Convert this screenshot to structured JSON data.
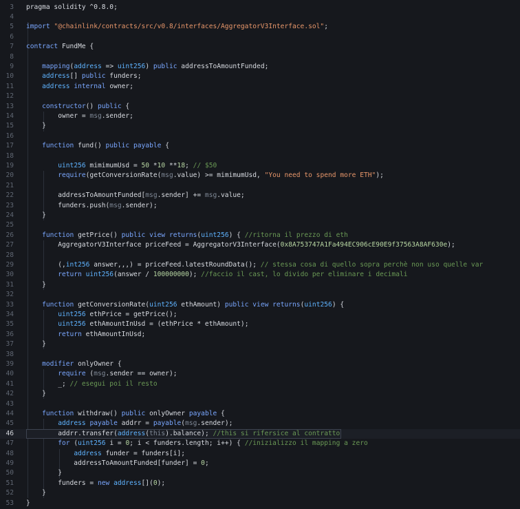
{
  "editor": {
    "language": "solidity",
    "active_line": 46,
    "colors": {
      "background": "#16181d",
      "keyword": "#7aa7ff",
      "type": "#5fb3ff",
      "string": "#e7966a",
      "number": "#b8d7a3",
      "comment": "#6a9955",
      "dim": "#7f8896",
      "gutter": "#5f6672"
    },
    "lines": [
      {
        "num": "3",
        "tokens": [
          {
            "t": "pragma solidity ^0.8.0;",
            "c": "id"
          }
        ]
      },
      {
        "num": "4",
        "tokens": []
      },
      {
        "num": "5",
        "tokens": [
          {
            "t": "import ",
            "c": "kw"
          },
          {
            "t": "\"@chainlink/contracts/src/v0.8/interfaces/AggregatorV3Interface.sol\"",
            "c": "str"
          },
          {
            "t": ";",
            "c": "id"
          }
        ]
      },
      {
        "num": "6",
        "tokens": []
      },
      {
        "num": "7",
        "tokens": [
          {
            "t": "contract ",
            "c": "kw"
          },
          {
            "t": "FundMe {",
            "c": "id"
          }
        ]
      },
      {
        "num": "8",
        "tokens": []
      },
      {
        "num": "9",
        "tokens": [
          {
            "t": "    ",
            "c": "id"
          },
          {
            "t": "mapping",
            "c": "kw"
          },
          {
            "t": "(",
            "c": "id"
          },
          {
            "t": "address",
            "c": "type"
          },
          {
            "t": " => ",
            "c": "id"
          },
          {
            "t": "uint256",
            "c": "type"
          },
          {
            "t": ") ",
            "c": "id"
          },
          {
            "t": "public",
            "c": "kw"
          },
          {
            "t": " addressToAmountFunded;",
            "c": "id"
          }
        ]
      },
      {
        "num": "10",
        "tokens": [
          {
            "t": "    ",
            "c": "id"
          },
          {
            "t": "address",
            "c": "type"
          },
          {
            "t": "[] ",
            "c": "id"
          },
          {
            "t": "public",
            "c": "kw"
          },
          {
            "t": " funders;",
            "c": "id"
          }
        ]
      },
      {
        "num": "11",
        "tokens": [
          {
            "t": "    ",
            "c": "id"
          },
          {
            "t": "address",
            "c": "type"
          },
          {
            "t": " ",
            "c": "id"
          },
          {
            "t": "internal",
            "c": "kw"
          },
          {
            "t": " owner;",
            "c": "id"
          }
        ]
      },
      {
        "num": "12",
        "tokens": []
      },
      {
        "num": "13",
        "tokens": [
          {
            "t": "    ",
            "c": "id"
          },
          {
            "t": "constructor",
            "c": "kw"
          },
          {
            "t": "() ",
            "c": "id"
          },
          {
            "t": "public",
            "c": "kw"
          },
          {
            "t": " {",
            "c": "id"
          }
        ]
      },
      {
        "num": "14",
        "tokens": [
          {
            "t": "        owner = ",
            "c": "id"
          },
          {
            "t": "msg",
            "c": "dim"
          },
          {
            "t": ".sender;",
            "c": "id"
          }
        ]
      },
      {
        "num": "15",
        "tokens": [
          {
            "t": "    }",
            "c": "id"
          }
        ]
      },
      {
        "num": "16",
        "tokens": []
      },
      {
        "num": "17",
        "tokens": [
          {
            "t": "    ",
            "c": "id"
          },
          {
            "t": "function",
            "c": "kw"
          },
          {
            "t": " fund() ",
            "c": "id"
          },
          {
            "t": "public",
            "c": "kw"
          },
          {
            "t": " ",
            "c": "id"
          },
          {
            "t": "payable",
            "c": "kw"
          },
          {
            "t": " {",
            "c": "id"
          }
        ]
      },
      {
        "num": "18",
        "tokens": []
      },
      {
        "num": "19",
        "tokens": [
          {
            "t": "        ",
            "c": "id"
          },
          {
            "t": "uint256",
            "c": "type"
          },
          {
            "t": " mimimumUsd = ",
            "c": "id"
          },
          {
            "t": "50",
            "c": "num"
          },
          {
            "t": " *",
            "c": "id"
          },
          {
            "t": "10",
            "c": "num"
          },
          {
            "t": " **",
            "c": "id"
          },
          {
            "t": "18",
            "c": "num"
          },
          {
            "t": "; ",
            "c": "id"
          },
          {
            "t": "// $50",
            "c": "cmt"
          }
        ]
      },
      {
        "num": "20",
        "tokens": [
          {
            "t": "        ",
            "c": "id"
          },
          {
            "t": "require",
            "c": "kw"
          },
          {
            "t": "(getConversionRate(",
            "c": "id"
          },
          {
            "t": "msg",
            "c": "dim"
          },
          {
            "t": ".value) >= mimimumUsd, ",
            "c": "id"
          },
          {
            "t": "\"You need to spend more ETH\"",
            "c": "str"
          },
          {
            "t": ");",
            "c": "id"
          }
        ]
      },
      {
        "num": "21",
        "tokens": []
      },
      {
        "num": "22",
        "tokens": [
          {
            "t": "        addressToAmountFunded[",
            "c": "id"
          },
          {
            "t": "msg",
            "c": "dim"
          },
          {
            "t": ".sender] += ",
            "c": "id"
          },
          {
            "t": "msg",
            "c": "dim"
          },
          {
            "t": ".value;",
            "c": "id"
          }
        ]
      },
      {
        "num": "23",
        "tokens": [
          {
            "t": "        funders.push(",
            "c": "id"
          },
          {
            "t": "msg",
            "c": "dim"
          },
          {
            "t": ".sender);",
            "c": "id"
          }
        ]
      },
      {
        "num": "24",
        "tokens": [
          {
            "t": "    }",
            "c": "id"
          }
        ]
      },
      {
        "num": "25",
        "tokens": []
      },
      {
        "num": "26",
        "tokens": [
          {
            "t": "    ",
            "c": "id"
          },
          {
            "t": "function",
            "c": "kw"
          },
          {
            "t": " getPrice() ",
            "c": "id"
          },
          {
            "t": "public",
            "c": "kw"
          },
          {
            "t": " ",
            "c": "id"
          },
          {
            "t": "view",
            "c": "kw"
          },
          {
            "t": " ",
            "c": "id"
          },
          {
            "t": "returns",
            "c": "kw"
          },
          {
            "t": "(",
            "c": "id"
          },
          {
            "t": "uint256",
            "c": "type"
          },
          {
            "t": ") { ",
            "c": "id"
          },
          {
            "t": "//ritorna il prezzo di eth",
            "c": "cmt"
          }
        ]
      },
      {
        "num": "27",
        "tokens": [
          {
            "t": "        AggregatorV3Interface priceFeed = AggregatorV3Interface(",
            "c": "id"
          },
          {
            "t": "0x8A753747A1Fa494EC906cE90E9f37563A8AF630e",
            "c": "num"
          },
          {
            "t": ");",
            "c": "id"
          }
        ]
      },
      {
        "num": "28",
        "tokens": []
      },
      {
        "num": "29",
        "tokens": [
          {
            "t": "        (,",
            "c": "id"
          },
          {
            "t": "int256",
            "c": "type"
          },
          {
            "t": " answer,,,) = priceFeed.latestRoundData(); ",
            "c": "id"
          },
          {
            "t": "// stessa cosa di quello sopra perchè non uso quelle var",
            "c": "cmt"
          }
        ]
      },
      {
        "num": "30",
        "tokens": [
          {
            "t": "        ",
            "c": "id"
          },
          {
            "t": "return",
            "c": "kw"
          },
          {
            "t": " ",
            "c": "id"
          },
          {
            "t": "uint256",
            "c": "type"
          },
          {
            "t": "(answer / ",
            "c": "id"
          },
          {
            "t": "100000000",
            "c": "num"
          },
          {
            "t": "); ",
            "c": "id"
          },
          {
            "t": "//faccio il cast, lo divido per eliminare i decimali",
            "c": "cmt"
          }
        ]
      },
      {
        "num": "31",
        "tokens": [
          {
            "t": "    }",
            "c": "id"
          }
        ]
      },
      {
        "num": "32",
        "tokens": []
      },
      {
        "num": "33",
        "tokens": [
          {
            "t": "    ",
            "c": "id"
          },
          {
            "t": "function",
            "c": "kw"
          },
          {
            "t": " getConversionRate(",
            "c": "id"
          },
          {
            "t": "uint256",
            "c": "type"
          },
          {
            "t": " ethAmount) ",
            "c": "id"
          },
          {
            "t": "public",
            "c": "kw"
          },
          {
            "t": " ",
            "c": "id"
          },
          {
            "t": "view",
            "c": "kw"
          },
          {
            "t": " ",
            "c": "id"
          },
          {
            "t": "returns",
            "c": "kw"
          },
          {
            "t": "(",
            "c": "id"
          },
          {
            "t": "uint256",
            "c": "type"
          },
          {
            "t": ") {",
            "c": "id"
          }
        ]
      },
      {
        "num": "34",
        "tokens": [
          {
            "t": "        ",
            "c": "id"
          },
          {
            "t": "uint256",
            "c": "type"
          },
          {
            "t": " ethPrice = getPrice();",
            "c": "id"
          }
        ]
      },
      {
        "num": "35",
        "tokens": [
          {
            "t": "        ",
            "c": "id"
          },
          {
            "t": "uint256",
            "c": "type"
          },
          {
            "t": " ethAmountInUsd = (ethPrice * ethAmount);",
            "c": "id"
          }
        ]
      },
      {
        "num": "36",
        "tokens": [
          {
            "t": "        ",
            "c": "id"
          },
          {
            "t": "return",
            "c": "kw"
          },
          {
            "t": " ethAmountInUsd;",
            "c": "id"
          }
        ]
      },
      {
        "num": "37",
        "tokens": [
          {
            "t": "    }",
            "c": "id"
          }
        ]
      },
      {
        "num": "38",
        "tokens": []
      },
      {
        "num": "39",
        "tokens": [
          {
            "t": "    ",
            "c": "id"
          },
          {
            "t": "modifier",
            "c": "kw"
          },
          {
            "t": " onlyOwner {",
            "c": "id"
          }
        ]
      },
      {
        "num": "40",
        "tokens": [
          {
            "t": "        ",
            "c": "id"
          },
          {
            "t": "require",
            "c": "kw"
          },
          {
            "t": " (",
            "c": "id"
          },
          {
            "t": "msg",
            "c": "dim"
          },
          {
            "t": ".sender == owner);",
            "c": "id"
          }
        ]
      },
      {
        "num": "41",
        "tokens": [
          {
            "t": "        _; ",
            "c": "id"
          },
          {
            "t": "// esegui poi il resto",
            "c": "cmt"
          }
        ]
      },
      {
        "num": "42",
        "tokens": [
          {
            "t": "    }",
            "c": "id"
          }
        ]
      },
      {
        "num": "43",
        "tokens": []
      },
      {
        "num": "44",
        "tokens": [
          {
            "t": "    ",
            "c": "id"
          },
          {
            "t": "function",
            "c": "kw"
          },
          {
            "t": " withdraw() ",
            "c": "id"
          },
          {
            "t": "public",
            "c": "kw"
          },
          {
            "t": " onlyOwner ",
            "c": "id"
          },
          {
            "t": "payable",
            "c": "kw"
          },
          {
            "t": " {",
            "c": "id"
          }
        ]
      },
      {
        "num": "45",
        "tokens": [
          {
            "t": "        ",
            "c": "id"
          },
          {
            "t": "address",
            "c": "type"
          },
          {
            "t": " ",
            "c": "id"
          },
          {
            "t": "payable",
            "c": "kw"
          },
          {
            "t": " addrr = ",
            "c": "id"
          },
          {
            "t": "payable",
            "c": "kw"
          },
          {
            "t": "(",
            "c": "id"
          },
          {
            "t": "msg",
            "c": "dim"
          },
          {
            "t": ".sender);",
            "c": "id"
          }
        ]
      },
      {
        "num": "46",
        "tokens": [
          {
            "t": "        addrr.transfer(",
            "c": "id"
          },
          {
            "t": "address",
            "c": "type"
          },
          {
            "t": "(",
            "c": "id"
          },
          {
            "t": "this",
            "c": "dim"
          },
          {
            "t": ").balance); ",
            "c": "id"
          },
          {
            "t": "//this si rifersice al contratto",
            "c": "cmt"
          }
        ]
      },
      {
        "num": "47",
        "tokens": [
          {
            "t": "        ",
            "c": "id"
          },
          {
            "t": "for",
            "c": "kw"
          },
          {
            "t": " (",
            "c": "id"
          },
          {
            "t": "uint256",
            "c": "type"
          },
          {
            "t": " i = ",
            "c": "id"
          },
          {
            "t": "0",
            "c": "num"
          },
          {
            "t": "; i < funders.length; i++) { ",
            "c": "id"
          },
          {
            "t": "//inizializzo il mapping a zero",
            "c": "cmt"
          }
        ]
      },
      {
        "num": "48",
        "tokens": [
          {
            "t": "            ",
            "c": "id"
          },
          {
            "t": "address",
            "c": "type"
          },
          {
            "t": " funder = funders[i];",
            "c": "id"
          }
        ]
      },
      {
        "num": "49",
        "tokens": [
          {
            "t": "            addressToAmountFunded[funder] = ",
            "c": "id"
          },
          {
            "t": "0",
            "c": "num"
          },
          {
            "t": ";",
            "c": "id"
          }
        ]
      },
      {
        "num": "50",
        "tokens": [
          {
            "t": "        }",
            "c": "id"
          }
        ]
      },
      {
        "num": "51",
        "tokens": [
          {
            "t": "        funders = ",
            "c": "id"
          },
          {
            "t": "new",
            "c": "kw"
          },
          {
            "t": " ",
            "c": "id"
          },
          {
            "t": "address",
            "c": "type"
          },
          {
            "t": "[](",
            "c": "id"
          },
          {
            "t": "0",
            "c": "num"
          },
          {
            "t": ");",
            "c": "id"
          }
        ]
      },
      {
        "num": "52",
        "tokens": [
          {
            "t": "    }",
            "c": "id"
          }
        ]
      },
      {
        "num": "53",
        "tokens": [
          {
            "t": "}",
            "c": "id"
          }
        ]
      }
    ]
  }
}
